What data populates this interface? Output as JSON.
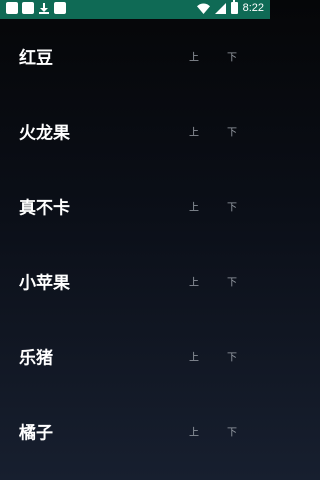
{
  "status_bar": {
    "time": "8:22",
    "left_icons": [
      "notification-box-icon",
      "notification-box-icon",
      "download-icon",
      "notification-box-icon"
    ],
    "right_icons": [
      "wifi-icon",
      "signal-icon",
      "battery-icon"
    ],
    "background_color": "#0f6a55"
  },
  "list": {
    "items": [
      {
        "name": "红豆",
        "up_label": "上",
        "down_label": "下"
      },
      {
        "name": "火龙果",
        "up_label": "上",
        "down_label": "下"
      },
      {
        "name": "真不卡",
        "up_label": "上",
        "down_label": "下"
      },
      {
        "name": "小苹果",
        "up_label": "上",
        "down_label": "下"
      },
      {
        "name": "乐猪",
        "up_label": "上",
        "down_label": "下"
      },
      {
        "name": "橘子",
        "up_label": "上",
        "down_label": "下"
      }
    ]
  }
}
